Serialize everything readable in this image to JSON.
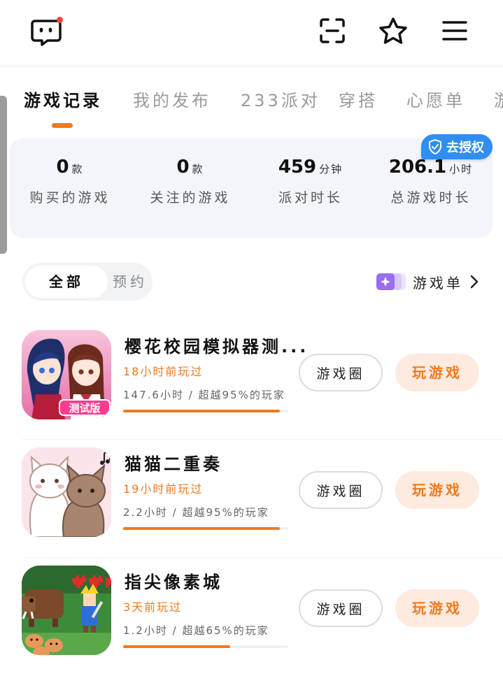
{
  "header": {
    "logo_icon": "chat-face-logo",
    "scan_icon": "scan-icon",
    "favorite_icon": "star-icon",
    "menu_icon": "menu-icon"
  },
  "tabs": [
    {
      "label": "游戏记录",
      "active": true
    },
    {
      "label": "我的发布",
      "active": false
    },
    {
      "label": "233派对",
      "active": false
    },
    {
      "label": "穿搭",
      "active": false
    },
    {
      "label": "心愿单",
      "active": false
    }
  ],
  "stats": {
    "authorize_label": "去授权",
    "items": [
      {
        "value": "0",
        "unit": "款",
        "label": "购买的游戏"
      },
      {
        "value": "0",
        "unit": "款",
        "label": "关注的游戏"
      },
      {
        "value": "459",
        "unit": "分钟",
        "label": "派对时长"
      },
      {
        "value": "206.1",
        "unit": "小时",
        "label": "总游戏时长"
      }
    ]
  },
  "filter": {
    "all_label": "全部",
    "reserve_label": "预约",
    "game_list_label": "游戏单"
  },
  "games": [
    {
      "title": "樱花校园模拟器测...",
      "played": "18小时前玩过",
      "stat": "147.6小时 / 超越95%的玩家",
      "progress": 0.95,
      "circle_label": "游戏圈",
      "play_label": "玩游戏",
      "cover_badge": "测试版"
    },
    {
      "title": "猫猫二重奏",
      "played": "19小时前玩过",
      "stat": "2.2小时 / 超越95%的玩家",
      "progress": 0.95,
      "circle_label": "游戏圈",
      "play_label": "玩游戏"
    },
    {
      "title": "指尖像素城",
      "played": "3天前玩过",
      "stat": "1.2小时 / 超越65%的玩家",
      "progress": 0.65,
      "circle_label": "游戏圈",
      "play_label": "玩游戏"
    }
  ],
  "colors": {
    "accent": "#f07a1c",
    "auth_blue": "#2f8ef2",
    "stats_bg": "#f3f5fb",
    "play_bg": "#feeade"
  }
}
